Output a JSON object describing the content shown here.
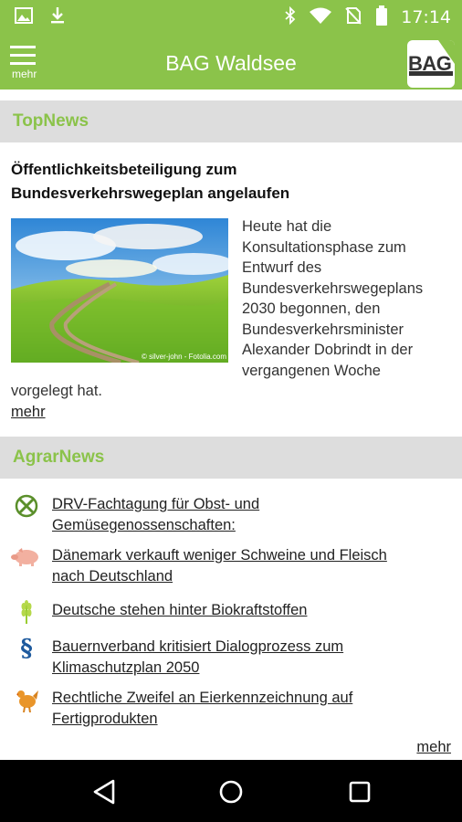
{
  "status_bar": {
    "time": "17:14",
    "icons_left": [
      "image-icon",
      "download-icon"
    ],
    "icons_right": [
      "bluetooth-icon",
      "wifi-icon",
      "no-sim-icon",
      "battery-icon"
    ]
  },
  "toolbar": {
    "menu_label": "mehr",
    "title": "BAG Waldsee",
    "logo_text": "BAG"
  },
  "topnews": {
    "header": "TopNews",
    "title_line1": "Öffentlichkeitsbeteiligung zum",
    "title_line2": "Bundesverkehrswegeplan angelaufen",
    "image_caption": "© silver-john - Fotolia.com",
    "text_lines": [
      "Heute hat die",
      "Konsultationsphase zum",
      "Entwurf des",
      "Bundesverkehrswegeplans",
      "2030 begonnen, den",
      "Bundesverkehrsminister",
      "Alexander Dobrindt in der",
      "vergangenen Woche"
    ],
    "text_last": "vorgelegt hat.",
    "more_label": "mehr"
  },
  "agrarnews": {
    "header": "AgrarNews",
    "items": [
      {
        "icon": "crossed-circle-icon",
        "line1": "DRV-Fachtagung für Obst- und",
        "line2": "Gemüsegenossenschaften:"
      },
      {
        "icon": "pig-icon",
        "line1": "Dänemark verkauft weniger Schweine und Fleisch",
        "line2": "nach Deutschland"
      },
      {
        "icon": "wheat-icon",
        "line1": "Deutsche stehen hinter Biokraftstoffen",
        "line2": ""
      },
      {
        "icon": "paragraph-icon",
        "line1": "Bauernverband kritisiert Dialogprozess zum",
        "line2": "Klimaschutzplan 2050"
      },
      {
        "icon": "chicken-icon",
        "line1": "Rechtliche Zweifel an Eierkennzeichnung auf",
        "line2": "Fertigprodukten"
      }
    ],
    "more_label": "mehr"
  },
  "nav_bar": {
    "buttons": [
      "back-icon",
      "home-icon",
      "recents-icon"
    ]
  },
  "colors": {
    "accent": "#8bc34a",
    "section_bg": "#dddddd",
    "nav_bg": "#000000"
  }
}
